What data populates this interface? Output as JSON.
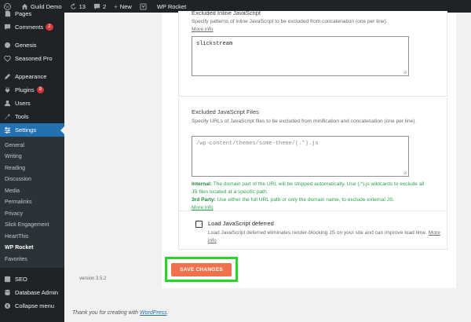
{
  "adminbar": {
    "site_name": "Guild Demo",
    "updates_count": "13",
    "comments_count": "2",
    "new_label": "New",
    "plugin_label": "WP Rocket"
  },
  "sidebar": {
    "items_top": [
      {
        "label": "Pages",
        "icon": "pages-icon"
      },
      {
        "label": "Comments",
        "icon": "comments-icon",
        "badge": "2"
      },
      {
        "label": "Genesis",
        "icon": "genesis-icon"
      },
      {
        "label": "Seasoned Pro",
        "icon": "heart-icon"
      },
      {
        "label": "Appearance",
        "icon": "appearance-icon"
      },
      {
        "label": "Plugins",
        "icon": "plugins-icon",
        "badge": "9"
      },
      {
        "label": "Users",
        "icon": "users-icon"
      },
      {
        "label": "Tools",
        "icon": "tools-icon"
      },
      {
        "label": "Settings",
        "icon": "settings-icon"
      }
    ],
    "submenu": [
      "General",
      "Writing",
      "Reading",
      "Discussion",
      "Media",
      "Permalinks",
      "Privacy",
      "Slick Engagement",
      "HeartThis",
      "WP Rocket",
      "Favorites"
    ],
    "items_bottom": [
      {
        "label": "SEO",
        "icon": "seo-icon"
      },
      {
        "label": "Database Admin",
        "icon": "database-icon"
      },
      {
        "label": "Collapse menu",
        "icon": "collapse-icon"
      }
    ]
  },
  "content": {
    "inline_js": {
      "title": "Excluded Inline JavaScript",
      "desc": "Specify patterns of inline JavaScript to be excluded from concatenation (one per line).",
      "more": "More info",
      "value": "slickstream"
    },
    "js_files": {
      "title": "Excluded JavaScript Files",
      "desc": "Specify URLs of JavaScript files to be excluded from minification and concatenation (one per line).",
      "placeholder": "/wp-content/themes/some-theme/(.*).js",
      "internal_label": "Internal:",
      "internal_text": "The domain part of the URL will be stripped automatically. Use (.*).js wildcards to exclude all JS files located at a specific path.",
      "third_party_label": "3rd Party:",
      "third_party_text": "Use either the full URL path or only the domain name, to exclude external JS.",
      "more": "More info"
    },
    "defer": {
      "title": "Load JavaScript deferred",
      "desc": "Load JavaScript deferred eliminates render-blocking JS on your site and can improve load time.",
      "more": "More info"
    },
    "save_label": "SAVE CHANGES",
    "version": "version 3.5.2"
  },
  "footer": {
    "text": "Thank you for creating with ",
    "link": "WordPress",
    "period": "."
  },
  "colors": {
    "sidebar_bg": "#1d2327",
    "current_menu": "#2271b1",
    "save_button": "#f0714b",
    "highlight_border": "#2bd42b",
    "note_green": "#2ea44f"
  }
}
